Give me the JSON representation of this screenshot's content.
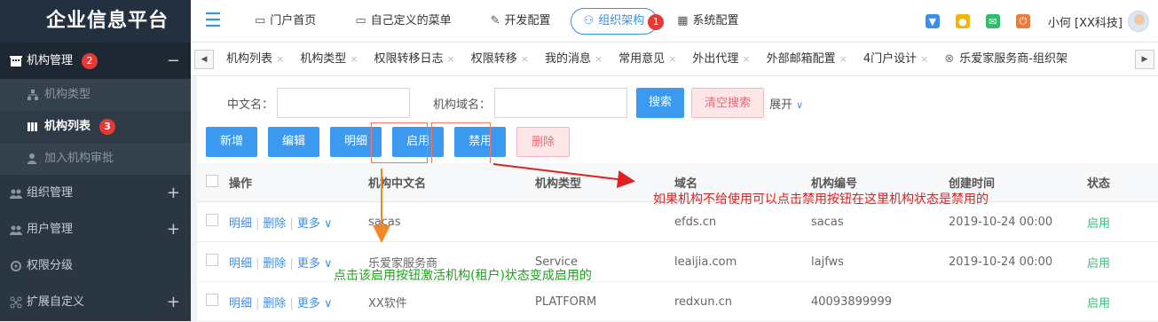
{
  "app_title": "企业信息平台",
  "sidebar": {
    "sections": [
      {
        "label": "机构管理",
        "badge": "2",
        "open": true,
        "toggle": "−"
      },
      {
        "label": "组织管理",
        "toggle": "+"
      },
      {
        "label": "用户管理",
        "toggle": "+"
      },
      {
        "label": "权限分级",
        "toggle": ""
      },
      {
        "label": "扩展自定义",
        "toggle": "+"
      }
    ],
    "sub_items": [
      {
        "label": "机构类型"
      },
      {
        "label": "机构列表",
        "badge": "3"
      },
      {
        "label": "加入机构审批"
      }
    ]
  },
  "topnav": {
    "items": [
      {
        "label": "门户首页",
        "icon": "monitor-icon"
      },
      {
        "label": "自己定义的菜单",
        "icon": "monitor-icon"
      },
      {
        "label": "开发配置",
        "icon": "wrench-icon"
      },
      {
        "label": "组织架构",
        "icon": "org-icon",
        "badge": "1"
      },
      {
        "label": "系统配置",
        "icon": "table-icon"
      }
    ],
    "username": "小何 [XX科技]"
  },
  "tabs": [
    "机构列表",
    "机构类型",
    "权限转移日志",
    "权限转移",
    "我的消息",
    "常用意见",
    "外出代理",
    "外部邮箱配置",
    "4门户设计",
    "乐爱家服务商-组织架"
  ],
  "search": {
    "name_label": "中文名：",
    "domain_label": "机构域名：",
    "search_button": "搜索",
    "clear_button": "清空搜索",
    "expand_label": "展开"
  },
  "actions": {
    "add": "新增",
    "edit": "编辑",
    "detail": "明细",
    "enable": "启用",
    "disable": "禁用",
    "delete": "删除"
  },
  "table": {
    "headers": {
      "op": "操作",
      "name": "机构中文名",
      "type": "机构类型",
      "domain": "域名",
      "code": "机构编号",
      "time": "创建时间",
      "status": "状态"
    },
    "row_links": {
      "detail": "明细",
      "delete": "删除",
      "more": "更多"
    },
    "rows": [
      {
        "name": "sacas",
        "type": "",
        "domain": "efds.cn",
        "code": "sacas",
        "time": "2019-10-24 00:00",
        "status": "启用"
      },
      {
        "name": "乐爱家服务商",
        "type": "Service",
        "domain": "leaijia.com",
        "code": "lajfws",
        "time": "2019-10-24 00:00",
        "status": "启用"
      },
      {
        "name": "XX软件",
        "type": "PLATFORM",
        "domain": "redxun.cn",
        "code": "40093899999",
        "time": "",
        "status": "启用"
      }
    ]
  },
  "annotations": {
    "red_note": "如果机构不给使用可以点击禁用按钮在这里机构状态是禁用的",
    "green_note": "点击该启用按钮激活机构(租户)状态变成启用的"
  },
  "colors": {
    "sidebar": "#2b3643",
    "accent": "#3b8fe6",
    "status_on": "#3bbf7a",
    "annotation_red": "#e02020",
    "annotation_green": "#1aa51a"
  }
}
